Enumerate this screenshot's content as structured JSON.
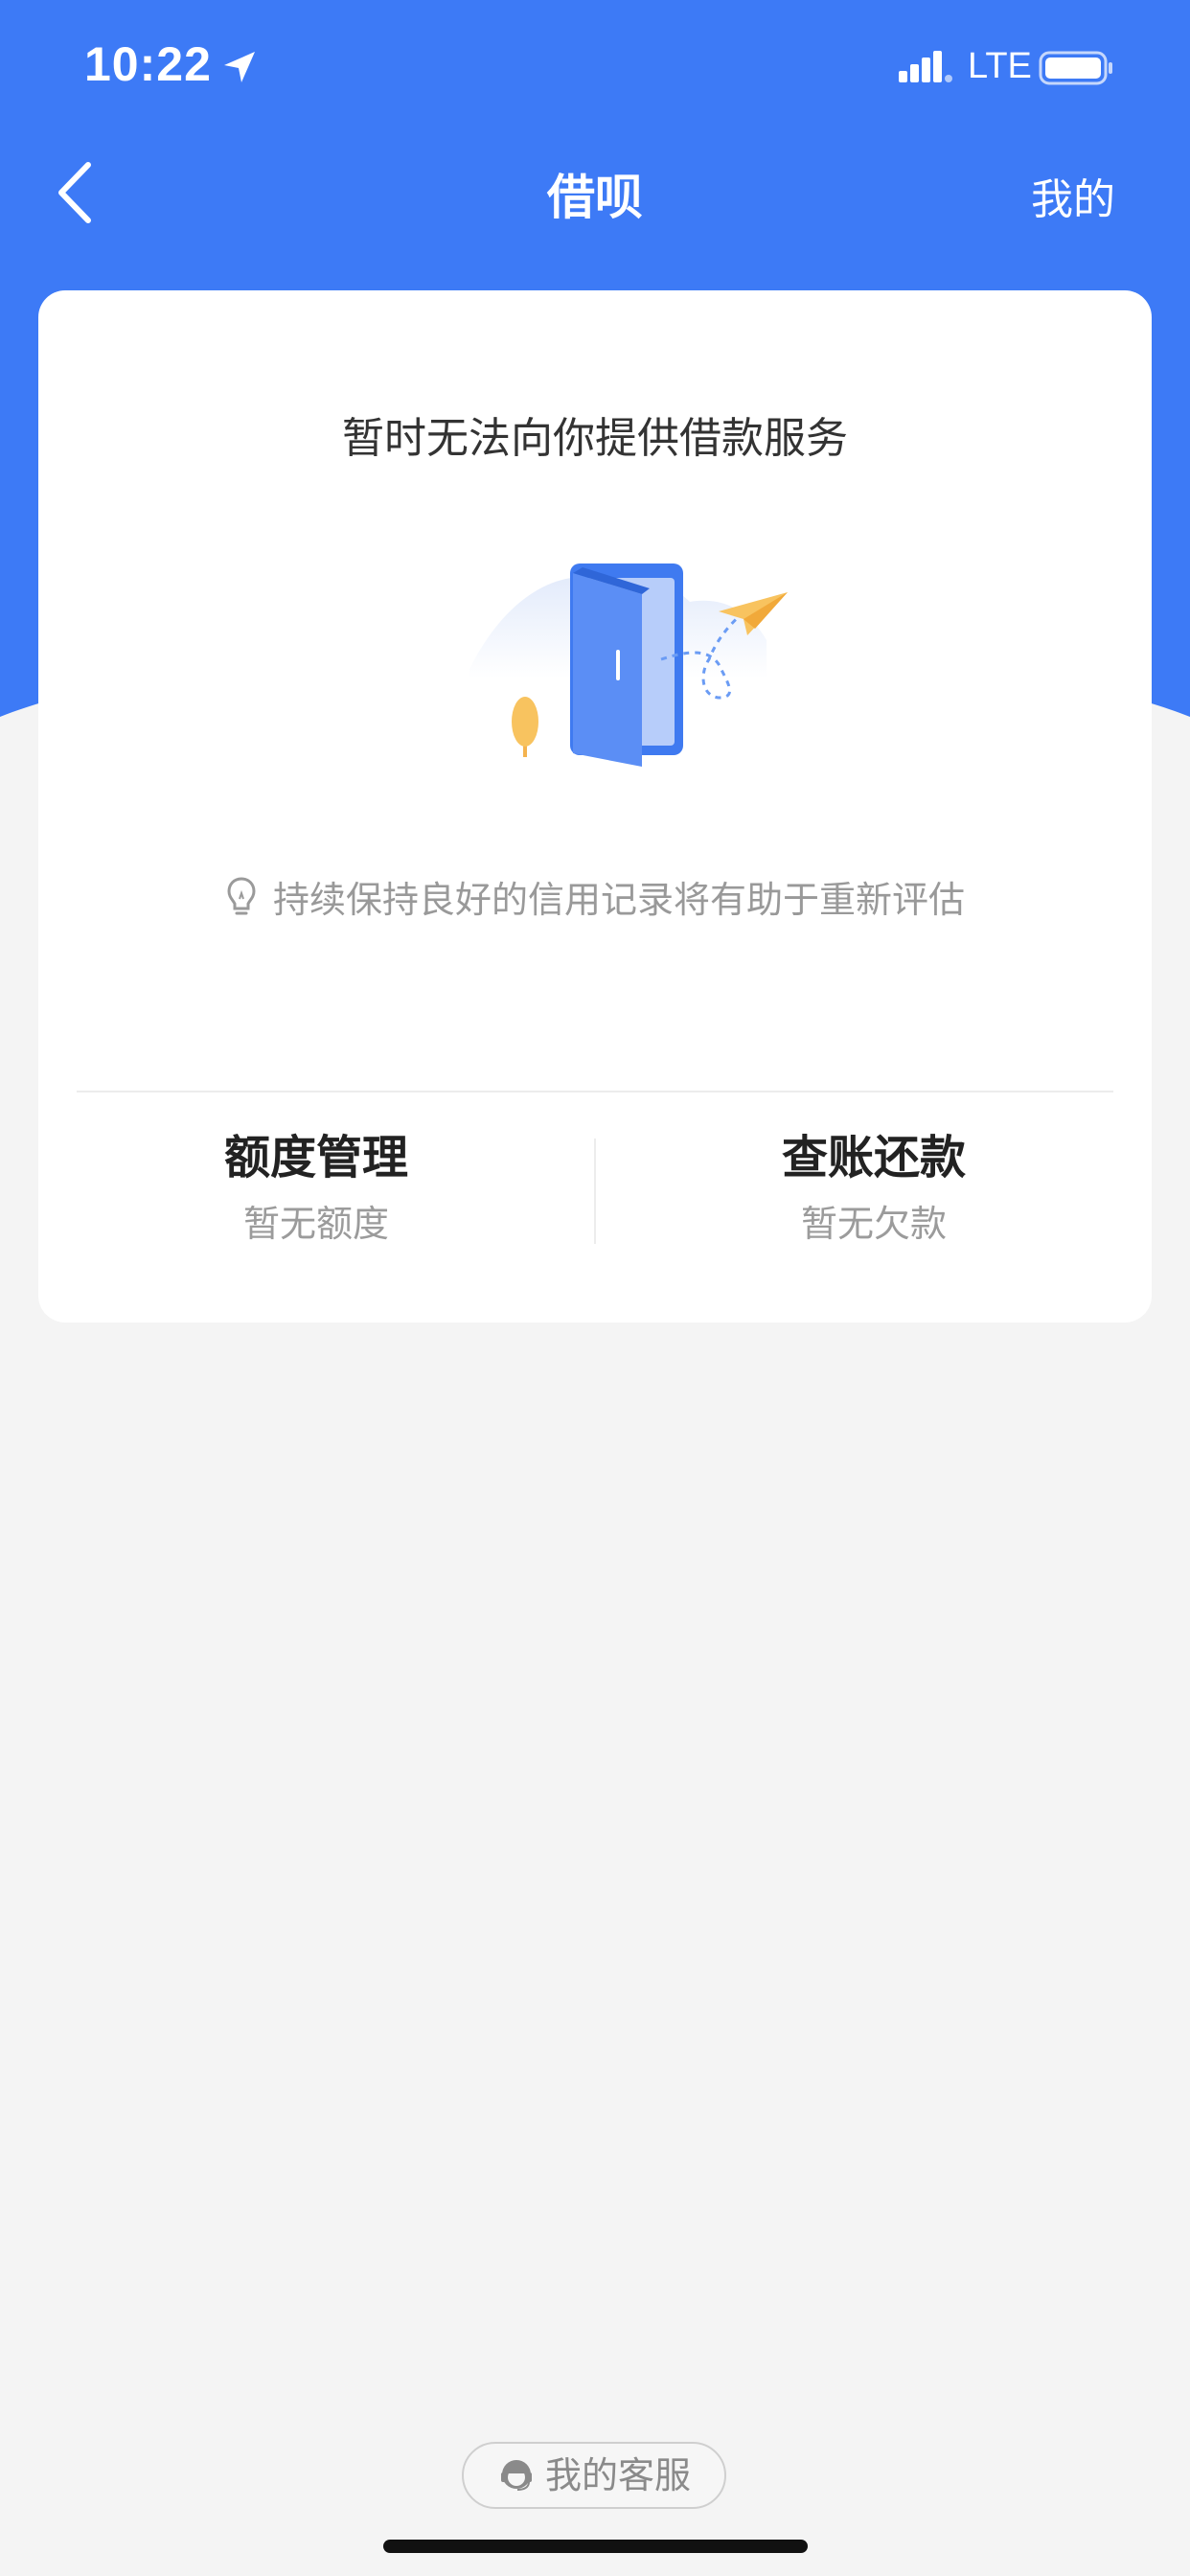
{
  "status_bar": {
    "time": "10:22",
    "network": "LTE",
    "location_icon": "location-arrow-icon",
    "signal_icon": "signal-bars-icon",
    "battery_icon": "battery-icon"
  },
  "nav": {
    "back_icon": "chevron-left-icon",
    "title": "借呗",
    "right_link": "我的"
  },
  "card": {
    "headline": "暂时无法向你提供借款服务",
    "illustration_icon": "open-door-illustration",
    "tip_icon": "lightbulb-icon",
    "tip": "持续保持良好的信用记录将有助于重新评估",
    "items": [
      {
        "title": "额度管理",
        "subtitle": "暂无额度"
      },
      {
        "title": "查账还款",
        "subtitle": "暂无欠款"
      }
    ]
  },
  "footer": {
    "service_icon": "customer-service-icon",
    "service_label": "我的客服"
  },
  "colors": {
    "brand_blue": "#3d7af6",
    "background": "#f4f4f4",
    "card": "#ffffff",
    "muted_text": "#999999"
  }
}
